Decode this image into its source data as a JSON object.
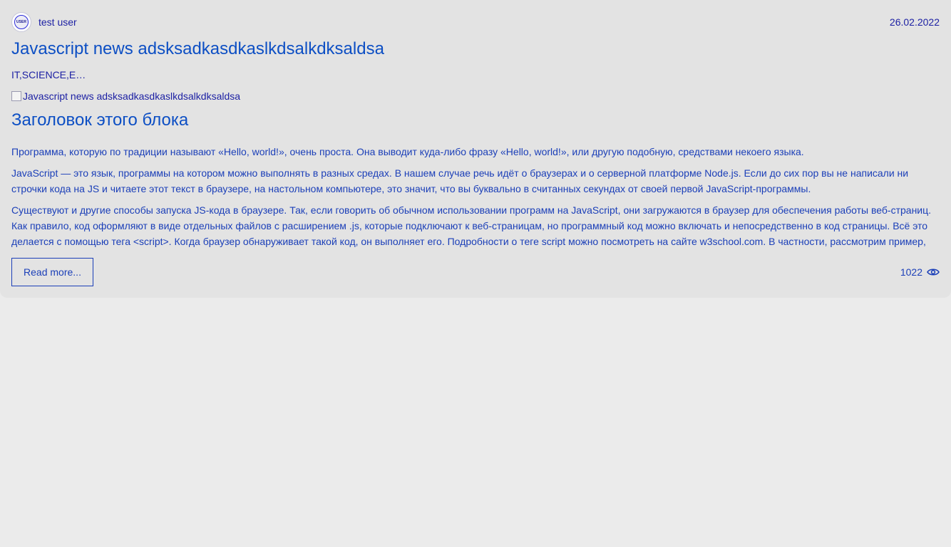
{
  "post": {
    "author": {
      "name": "test user",
      "avatar_text": "USER"
    },
    "date": "26.02.2022",
    "title": "Javascript news adsksadkasdkaslkdsalkdksaldsa",
    "tags": "IT,SCIENCE,ECONOMY",
    "image_alt": "Javascript news adsksadkasdkaslkdsalkdksaldsa",
    "block_title": "Заголовок этого блока",
    "paragraphs": [
      "Программа, которую по традиции называют «Hello, world!», очень проста. Она выводит куда-либо фразу «Hello, world!», или другую подобную, средствами некоего языка.",
      "JavaScript — это язык, программы на котором можно выполнять в разных средах. В нашем случае речь идёт о браузерах и о серверной платформе Node.js. Если до сих пор вы не написали ни строчки кода на JS и читаете этот текст в браузере, на настольном компьютере, это значит, что вы буквально в считанных секундах от своей первой JavaScript-программы.",
      "Существуют и другие способы запуска JS-кода в браузере. Так, если говорить об обычном использовании программ на JavaScript, они загружаются в браузер для обеспечения работы веб-страниц. Как правило, код оформляют в виде отдельных файлов с расширением .js, которые подключают к веб-страницам, но программный код можно включать и непосредственно в код страницы. Всё это делается с помощью тега <script>. Когда браузер обнаруживает такой код, он выполняет его. Подробности о теге script можно посмотреть на сайте w3school.com. В частности, рассмотрим пример,"
    ],
    "read_more_label": "Read more...",
    "views": "1022",
    "views_icon": "eye-icon"
  },
  "colors": {
    "page_bg": "#ebebeb",
    "card_bg": "#e3e3e3",
    "title": "#0d4fc4",
    "text": "#1b3fb8"
  }
}
